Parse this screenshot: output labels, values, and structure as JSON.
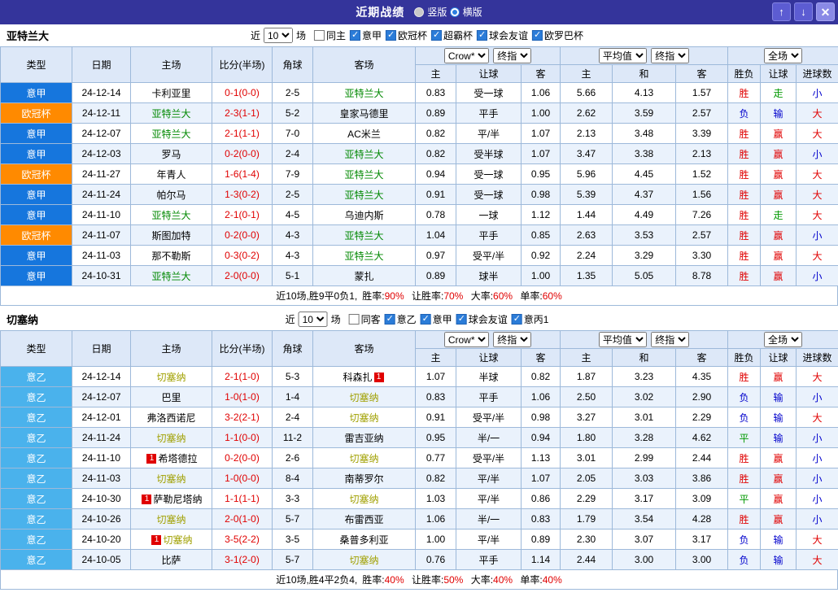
{
  "titlebar": {
    "title": "近期战绩",
    "radios": [
      {
        "label": "竖版",
        "selected": false
      },
      {
        "label": "横版",
        "selected": true
      }
    ],
    "icons": {
      "up": "↑",
      "down": "↓",
      "close": "✕"
    }
  },
  "colors": {
    "titlebar_bg": "#34349b",
    "header_bg": "#dde8f8",
    "grid_border": "#9db9da",
    "type": {
      "意甲": "#1676dd",
      "欧冠杯": "#ff8a00",
      "意乙": "#4ab2ec"
    },
    "result": {
      "胜": "#e00000",
      "赢": "#e00000",
      "大": "#e00000",
      "负": "#0000cc",
      "输": "#0000cc",
      "小": "#0000cc",
      "平": "#009900",
      "走": "#009900"
    },
    "score": "#e00000",
    "badge": "#e00000"
  },
  "columns": {
    "type": "类型",
    "date": "日期",
    "home": "主场",
    "score": "比分(半场)",
    "corner": "角球",
    "away": "客场",
    "h": "主",
    "handicap": "让球",
    "a": "客",
    "avg_h": "主",
    "avg_d": "和",
    "avg_a": "客",
    "result": "胜负",
    "handicap_result": "让球",
    "goals": "进球数"
  },
  "sections": [
    {
      "team": "亚特兰大",
      "team_color": "#008800",
      "filter": {
        "near": "近",
        "count": "10",
        "games": "场",
        "checkboxes": [
          {
            "label": "同主",
            "checked": false
          },
          {
            "label": "意甲",
            "checked": true
          },
          {
            "label": "欧冠杯",
            "checked": true
          },
          {
            "label": "超霸杯",
            "checked": true
          },
          {
            "label": "球会友谊",
            "checked": true
          },
          {
            "label": "欧罗巴杯",
            "checked": true
          }
        ]
      },
      "dropdowns": {
        "company": "Crow*",
        "stage1": "终指",
        "avg": "平均值",
        "stage2": "终指",
        "scope": "全场"
      },
      "rows": [
        {
          "type": "意甲",
          "date": "24-12-14",
          "home": "卡利亚里",
          "home_hl": false,
          "score": "0-1(0-0)",
          "corner": "2-5",
          "away": "亚特兰大",
          "away_hl": true,
          "odds_home": "0.83",
          "handicap": "受一球",
          "odds_away": "1.06",
          "avg_home": "5.66",
          "avg_draw": "4.13",
          "avg_away": "1.57",
          "result": "胜",
          "handicap_result": "走",
          "goals_result": "小"
        },
        {
          "type": "欧冠杯",
          "date": "24-12-11",
          "home": "亚特兰大",
          "home_hl": true,
          "score": "2-3(1-1)",
          "corner": "5-2",
          "away": "皇家马德里",
          "away_hl": false,
          "odds_home": "0.89",
          "handicap": "平手",
          "odds_away": "1.00",
          "avg_home": "2.62",
          "avg_draw": "3.59",
          "avg_away": "2.57",
          "result": "负",
          "handicap_result": "输",
          "goals_result": "大"
        },
        {
          "type": "意甲",
          "date": "24-12-07",
          "home": "亚特兰大",
          "home_hl": true,
          "score": "2-1(1-1)",
          "corner": "7-0",
          "away": "AC米兰",
          "away_hl": false,
          "odds_home": "0.82",
          "handicap": "平/半",
          "odds_away": "1.07",
          "avg_home": "2.13",
          "avg_draw": "3.48",
          "avg_away": "3.39",
          "result": "胜",
          "handicap_result": "赢",
          "goals_result": "大"
        },
        {
          "type": "意甲",
          "date": "24-12-03",
          "home": "罗马",
          "home_hl": false,
          "score": "0-2(0-0)",
          "corner": "2-4",
          "away": "亚特兰大",
          "away_hl": true,
          "odds_home": "0.82",
          "handicap": "受半球",
          "odds_away": "1.07",
          "avg_home": "3.47",
          "avg_draw": "3.38",
          "avg_away": "2.13",
          "result": "胜",
          "handicap_result": "赢",
          "goals_result": "小"
        },
        {
          "type": "欧冠杯",
          "date": "24-11-27",
          "home": "年青人",
          "home_hl": false,
          "score": "1-6(1-4)",
          "corner": "7-9",
          "away": "亚特兰大",
          "away_hl": true,
          "odds_home": "0.94",
          "handicap": "受一球",
          "odds_away": "0.95",
          "avg_home": "5.96",
          "avg_draw": "4.45",
          "avg_away": "1.52",
          "result": "胜",
          "handicap_result": "赢",
          "goals_result": "大"
        },
        {
          "type": "意甲",
          "date": "24-11-24",
          "home": "帕尔马",
          "home_hl": false,
          "score": "1-3(0-2)",
          "corner": "2-5",
          "away": "亚特兰大",
          "away_hl": true,
          "odds_home": "0.91",
          "handicap": "受一球",
          "odds_away": "0.98",
          "avg_home": "5.39",
          "avg_draw": "4.37",
          "avg_away": "1.56",
          "result": "胜",
          "handicap_result": "赢",
          "goals_result": "大"
        },
        {
          "type": "意甲",
          "date": "24-11-10",
          "home": "亚特兰大",
          "home_hl": true,
          "score": "2-1(0-1)",
          "corner": "4-5",
          "away": "乌迪内斯",
          "away_hl": false,
          "odds_home": "0.78",
          "handicap": "一球",
          "odds_away": "1.12",
          "avg_home": "1.44",
          "avg_draw": "4.49",
          "avg_away": "7.26",
          "result": "胜",
          "handicap_result": "走",
          "goals_result": "大"
        },
        {
          "type": "欧冠杯",
          "date": "24-11-07",
          "home": "斯图加特",
          "home_hl": false,
          "score": "0-2(0-0)",
          "corner": "4-3",
          "away": "亚特兰大",
          "away_hl": true,
          "odds_home": "1.04",
          "handicap": "平手",
          "odds_away": "0.85",
          "avg_home": "2.63",
          "avg_draw": "3.53",
          "avg_away": "2.57",
          "result": "胜",
          "handicap_result": "赢",
          "goals_result": "小"
        },
        {
          "type": "意甲",
          "date": "24-11-03",
          "home": "那不勒斯",
          "home_hl": false,
          "score": "0-3(0-2)",
          "corner": "4-3",
          "away": "亚特兰大",
          "away_hl": true,
          "odds_home": "0.97",
          "handicap": "受平/半",
          "odds_away": "0.92",
          "avg_home": "2.24",
          "avg_draw": "3.29",
          "avg_away": "3.30",
          "result": "胜",
          "handicap_result": "赢",
          "goals_result": "大"
        },
        {
          "type": "意甲",
          "date": "24-10-31",
          "home": "亚特兰大",
          "home_hl": true,
          "score": "2-0(0-0)",
          "corner": "5-1",
          "away": "蒙扎",
          "away_hl": false,
          "odds_home": "0.89",
          "handicap": "球半",
          "odds_away": "1.00",
          "avg_home": "1.35",
          "avg_draw": "5.05",
          "avg_away": "8.78",
          "result": "胜",
          "handicap_result": "赢",
          "goals_result": "小"
        }
      ],
      "summary": {
        "prefix": "近10场,胜9平0负1,",
        "stats": [
          {
            "label": "胜率:",
            "value": "90%"
          },
          {
            "label": "让胜率:",
            "value": "70%"
          },
          {
            "label": "大率:",
            "value": "60%"
          },
          {
            "label": "单率:",
            "value": "60%"
          }
        ]
      }
    },
    {
      "team": "切塞纳",
      "team_color": "#a0a000",
      "filter": {
        "near": "近",
        "count": "10",
        "games": "场",
        "checkboxes": [
          {
            "label": "同客",
            "checked": false
          },
          {
            "label": "意乙",
            "checked": true
          },
          {
            "label": "意甲",
            "checked": true
          },
          {
            "label": "球会友谊",
            "checked": true
          },
          {
            "label": "意丙1",
            "checked": true
          }
        ]
      },
      "dropdowns": {
        "company": "Crow*",
        "stage1": "终指",
        "avg": "平均值",
        "stage2": "终指",
        "scope": "全场"
      },
      "rows": [
        {
          "type": "意乙",
          "date": "24-12-14",
          "home": "切塞纳",
          "home_hl": true,
          "score": "2-1(1-0)",
          "corner": "5-3",
          "away": "科森扎",
          "away_badge": "1",
          "away_hl": false,
          "odds_home": "1.07",
          "handicap": "半球",
          "odds_away": "0.82",
          "avg_home": "1.87",
          "avg_draw": "3.23",
          "avg_away": "4.35",
          "result": "胜",
          "handicap_result": "赢",
          "goals_result": "大"
        },
        {
          "type": "意乙",
          "date": "24-12-07",
          "home": "巴里",
          "home_hl": false,
          "score": "1-0(1-0)",
          "corner": "1-4",
          "away": "切塞纳",
          "away_hl": true,
          "odds_home": "0.83",
          "handicap": "平手",
          "odds_away": "1.06",
          "avg_home": "2.50",
          "avg_draw": "3.02",
          "avg_away": "2.90",
          "result": "负",
          "handicap_result": "输",
          "goals_result": "小"
        },
        {
          "type": "意乙",
          "date": "24-12-01",
          "home": "弗洛西诺尼",
          "home_hl": false,
          "score": "3-2(2-1)",
          "corner": "2-4",
          "away": "切塞纳",
          "away_hl": true,
          "odds_home": "0.91",
          "handicap": "受平/半",
          "odds_away": "0.98",
          "avg_home": "3.27",
          "avg_draw": "3.01",
          "avg_away": "2.29",
          "result": "负",
          "handicap_result": "输",
          "goals_result": "大"
        },
        {
          "type": "意乙",
          "date": "24-11-24",
          "home": "切塞纳",
          "home_hl": true,
          "score": "1-1(0-0)",
          "corner": "11-2",
          "away": "雷吉亚纳",
          "away_hl": false,
          "odds_home": "0.95",
          "handicap": "半/一",
          "odds_away": "0.94",
          "avg_home": "1.80",
          "avg_draw": "3.28",
          "avg_away": "4.62",
          "result": "平",
          "handicap_result": "输",
          "goals_result": "小"
        },
        {
          "type": "意乙",
          "date": "24-11-10",
          "home": "希塔德拉",
          "home_badge": "1",
          "home_hl": false,
          "score": "0-2(0-0)",
          "corner": "2-6",
          "away": "切塞纳",
          "away_hl": true,
          "odds_home": "0.77",
          "handicap": "受平/半",
          "odds_away": "1.13",
          "avg_home": "3.01",
          "avg_draw": "2.99",
          "avg_away": "2.44",
          "result": "胜",
          "handicap_result": "赢",
          "goals_result": "小"
        },
        {
          "type": "意乙",
          "date": "24-11-03",
          "home": "切塞纳",
          "home_hl": true,
          "score": "1-0(0-0)",
          "corner": "8-4",
          "away": "南蒂罗尔",
          "away_hl": false,
          "odds_home": "0.82",
          "handicap": "平/半",
          "odds_away": "1.07",
          "avg_home": "2.05",
          "avg_draw": "3.03",
          "avg_away": "3.86",
          "result": "胜",
          "handicap_result": "赢",
          "goals_result": "小"
        },
        {
          "type": "意乙",
          "date": "24-10-30",
          "home": "萨勒尼塔纳",
          "home_badge": "1",
          "home_hl": false,
          "score": "1-1(1-1)",
          "corner": "3-3",
          "away": "切塞纳",
          "away_hl": true,
          "odds_home": "1.03",
          "handicap": "平/半",
          "odds_away": "0.86",
          "avg_home": "2.29",
          "avg_draw": "3.17",
          "avg_away": "3.09",
          "result": "平",
          "handicap_result": "赢",
          "goals_result": "小"
        },
        {
          "type": "意乙",
          "date": "24-10-26",
          "home": "切塞纳",
          "home_hl": true,
          "score": "2-0(1-0)",
          "corner": "5-7",
          "away": "布雷西亚",
          "away_hl": false,
          "odds_home": "1.06",
          "handicap": "半/一",
          "odds_away": "0.83",
          "avg_home": "1.79",
          "avg_draw": "3.54",
          "avg_away": "4.28",
          "result": "胜",
          "handicap_result": "赢",
          "goals_result": "小"
        },
        {
          "type": "意乙",
          "date": "24-10-20",
          "home": "切塞纳",
          "home_badge": "1",
          "home_hl": true,
          "score": "3-5(2-2)",
          "corner": "3-5",
          "away": "桑普多利亚",
          "away_hl": false,
          "odds_home": "1.00",
          "handicap": "平/半",
          "odds_away": "0.89",
          "avg_home": "2.30",
          "avg_draw": "3.07",
          "avg_away": "3.17",
          "result": "负",
          "handicap_result": "输",
          "goals_result": "大"
        },
        {
          "type": "意乙",
          "date": "24-10-05",
          "home": "比萨",
          "home_hl": false,
          "score": "3-1(2-0)",
          "corner": "5-7",
          "away": "切塞纳",
          "away_hl": true,
          "odds_home": "0.76",
          "handicap": "平手",
          "odds_away": "1.14",
          "avg_home": "2.44",
          "avg_draw": "3.00",
          "avg_away": "3.00",
          "result": "负",
          "handicap_result": "输",
          "goals_result": "大"
        }
      ],
      "summary": {
        "prefix": "近10场,胜4平2负4,",
        "stats": [
          {
            "label": "胜率:",
            "value": "40%"
          },
          {
            "label": "让胜率:",
            "value": "50%"
          },
          {
            "label": "大率:",
            "value": "40%"
          },
          {
            "label": "单率:",
            "value": "40%"
          }
        ]
      }
    }
  ]
}
